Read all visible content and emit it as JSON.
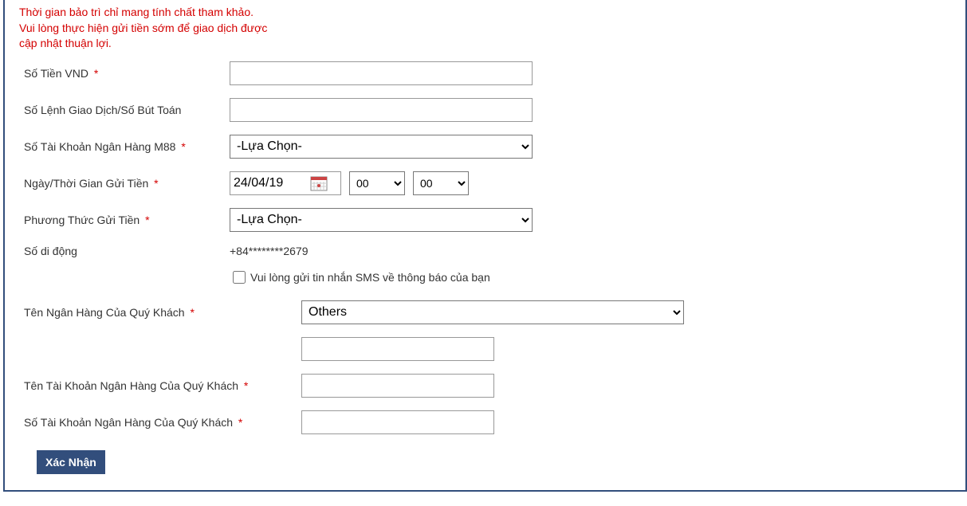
{
  "notice": {
    "line1": "Thời gian bảo trì chỉ mang tính chất tham khảo.",
    "line2": "Vui lòng thực hiện gửi tiền sớm để giao dịch được",
    "line3": "cập nhật thuận lợi."
  },
  "labels": {
    "amount": "Số Tiền VND",
    "txn_ref": "Số Lệnh Giao Dịch/Số Bút Toán",
    "m88_account": "Số Tài Khoản Ngân Hàng M88",
    "deposit_datetime": "Ngày/Thời Gian Gửi Tiền",
    "deposit_method": "Phương Thức Gửi Tiền",
    "mobile": "Số di động",
    "sms_checkbox": "Vui lòng gửi tin nhắn SMS về thông báo của bạn",
    "cust_bank_name": "Tên Ngân Hàng Của Quý Khách",
    "cust_account_name": "Tên Tài Khoản Ngân Hàng Của Quý Khách",
    "cust_account_no": "Số Tài Khoản Ngân Hàng Của Quý Khách"
  },
  "values": {
    "amount": "",
    "txn_ref": "",
    "m88_account_selected": "-Lựa Chọn-",
    "date": "24/04/19",
    "hour": "00",
    "minute": "00",
    "deposit_method_selected": "-Lựa Chọn-",
    "mobile": "+84********2679",
    "cust_bank_selected": "Others",
    "cust_bank_other": "",
    "cust_account_name": "",
    "cust_account_no": ""
  },
  "actions": {
    "submit": "Xác Nhận"
  }
}
